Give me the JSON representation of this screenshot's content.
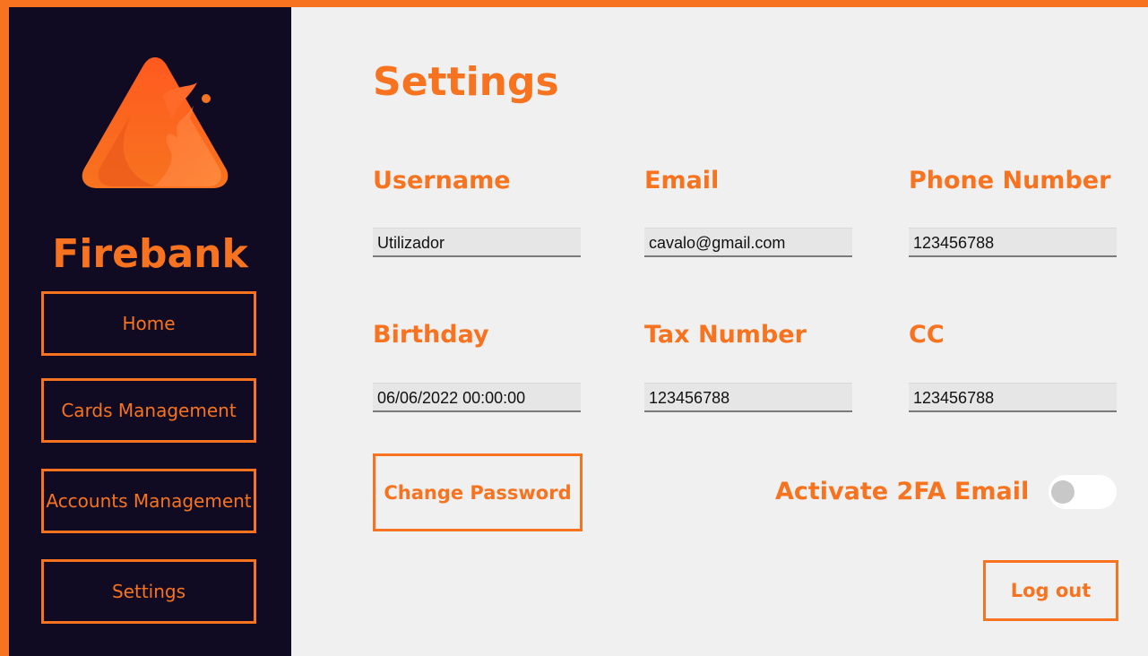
{
  "app": {
    "brand": "Firebank",
    "accent_color": "#F7731F",
    "sidebar_color": "#100B22",
    "logo_icon": "flame-triangle-icon"
  },
  "sidebar": {
    "items": [
      {
        "label": "Home",
        "selected": false
      },
      {
        "label": "Cards Management",
        "selected": false
      },
      {
        "label": "Accounts Management",
        "selected": false
      },
      {
        "label": "Settings",
        "selected": true
      }
    ]
  },
  "page": {
    "title": "Settings"
  },
  "fields": {
    "username": {
      "label": "Username",
      "value": "Utilizador"
    },
    "email": {
      "label": "Email",
      "value": "cavalo@gmail.com"
    },
    "phone": {
      "label": "Phone Number",
      "value": "123456788"
    },
    "birthday": {
      "label": "Birthday",
      "value": "06/06/2022 00:00:00"
    },
    "tax_number": {
      "label": "Tax Number",
      "value": "123456788"
    },
    "cc": {
      "label": "CC",
      "value": "123456788"
    }
  },
  "actions": {
    "change_password": "Change Password",
    "twofa_label": "Activate 2FA Email",
    "twofa_enabled": false,
    "logout": "Log out"
  }
}
